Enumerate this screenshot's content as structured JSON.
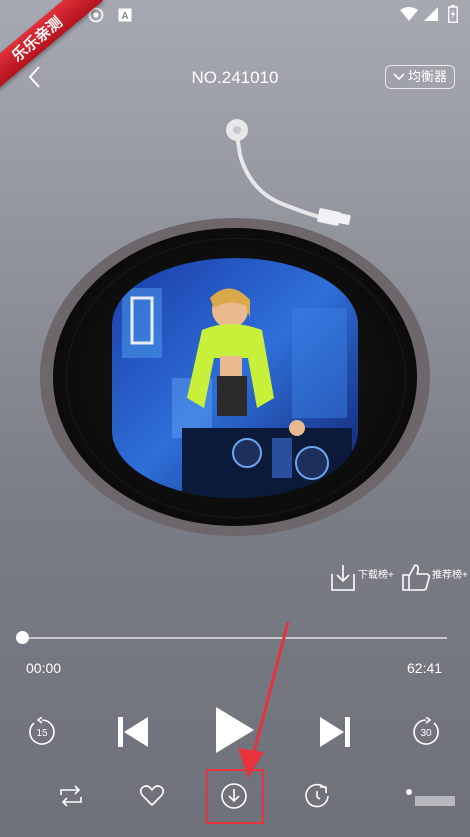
{
  "watermark": "乐乐亲测",
  "status_bar": {
    "left_icons": [
      "target-icon",
      "a-box-icon"
    ],
    "right_icons": [
      "wifi-icon",
      "signal-icon",
      "battery-charging-icon"
    ]
  },
  "header": {
    "title": "NO.241010",
    "equalizer_label": "均衡器"
  },
  "rank_buttons": {
    "download_rank": "下载榜+",
    "recommend_rank": "推荐榜+"
  },
  "progress": {
    "current": "00:00",
    "total": "62:41",
    "fraction": 0.0
  },
  "controls": {
    "rewind_seconds": "15",
    "forward_seconds": "30"
  },
  "colors": {
    "highlight": "#e8323c",
    "background_top": "#a6a9b1",
    "background_bottom": "#6f717a"
  }
}
